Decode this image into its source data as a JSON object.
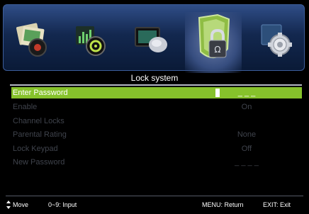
{
  "menu_tabs": [
    {
      "name": "picture-tab",
      "icon": "picture-icon"
    },
    {
      "name": "sound-tab",
      "icon": "sound-icon"
    },
    {
      "name": "channel-tab",
      "icon": "channel-icon"
    },
    {
      "name": "lock-tab",
      "icon": "lock-icon",
      "selected": true
    },
    {
      "name": "setup-tab",
      "icon": "gear-icon"
    }
  ],
  "title": "Lock system",
  "items": [
    {
      "label": "Enter Password",
      "value": "_ _ _",
      "active": true
    },
    {
      "label": "Enable",
      "value": "On"
    },
    {
      "label": "Channel Locks",
      "value": ""
    },
    {
      "label": "Parental Rating",
      "value": "None"
    },
    {
      "label": "Lock Keypad",
      "value": "Off"
    },
    {
      "label": "New Password",
      "value": "_ _ _ _"
    }
  ],
  "footer": {
    "move": "Move",
    "input": "0~9: Input",
    "return": "MENU: Return",
    "exit": "EXIT: Exit"
  },
  "colors": {
    "highlight": "#86c22b",
    "disabled_text": "#3f434c",
    "background": "#000000"
  }
}
